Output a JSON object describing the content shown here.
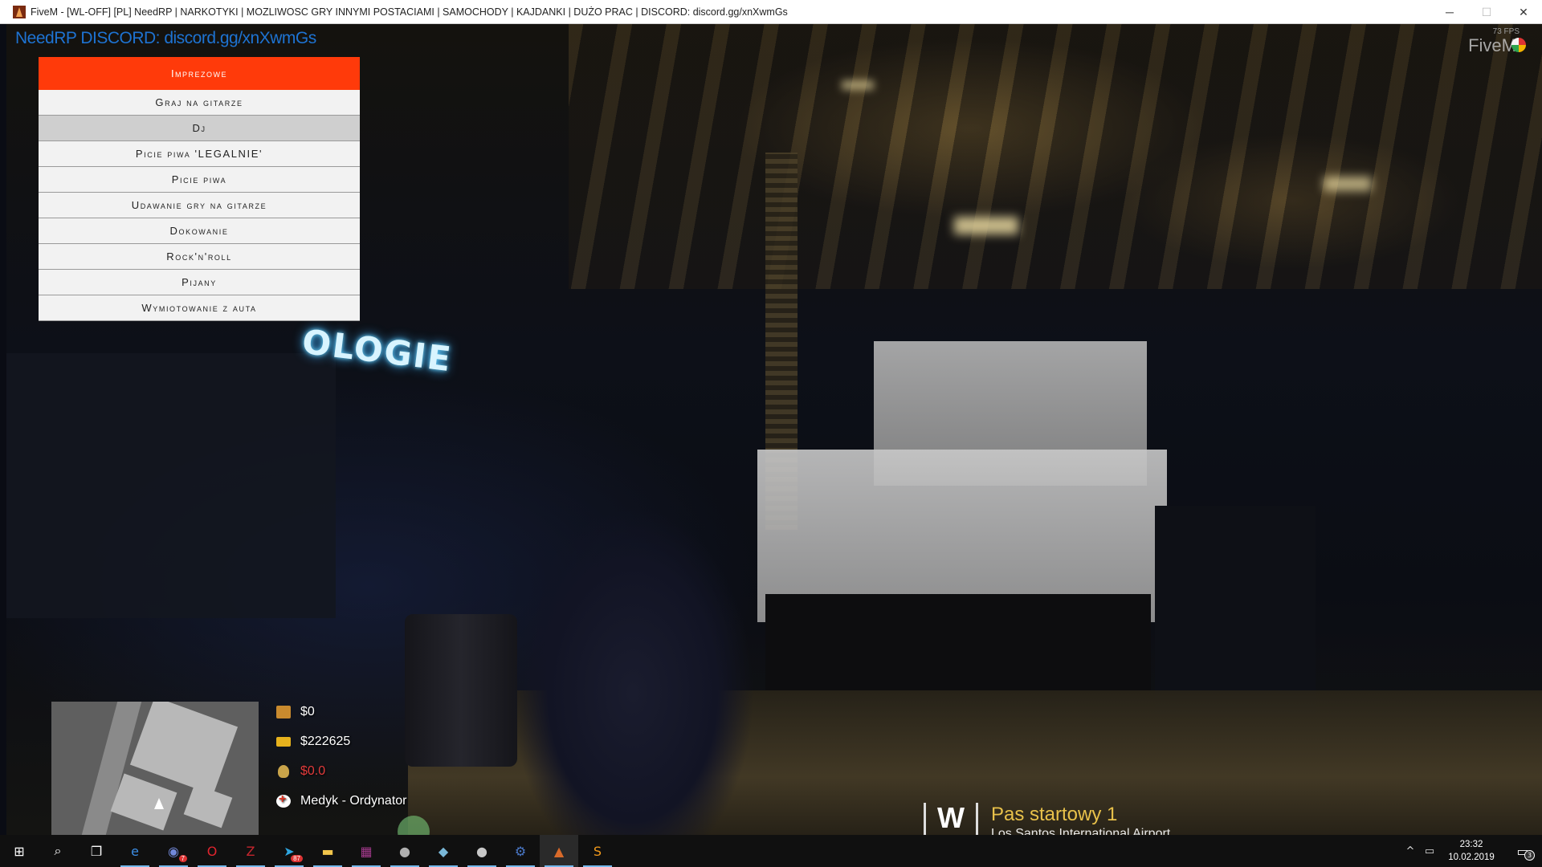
{
  "window": {
    "title": "FiveM - [WL-OFF] [PL] NeedRP | NARKOTYKI | MOZLIWOSC GRY INNYMI POSTACIAMI | SAMOCHODY | KAJDANKI | DUŻO PRAC | DISCORD: discord.gg/xnXwmGs",
    "minimize": "─",
    "maximize": "☐",
    "close": "✕"
  },
  "overlay": {
    "server_banner": "NeedRP DISCORD: discord.gg/xnXwmGs",
    "fps": "73 FPS",
    "brand": "FiveM",
    "neon_sign": "OLOGIE"
  },
  "menu": {
    "header": "Imprezowe",
    "selected_index": 1,
    "items": [
      {
        "label": "Graj na gitarze"
      },
      {
        "label": "Dj"
      },
      {
        "label": "Picie piwa 'LEGALNIE'"
      },
      {
        "label": "Picie piwa"
      },
      {
        "label": "Udawanie gry na gitarze"
      },
      {
        "label": "Dokowanie"
      },
      {
        "label": "Rock'n'roll"
      },
      {
        "label": "Pijany"
      },
      {
        "label": "Wymiotowanie z auta"
      }
    ]
  },
  "hud": {
    "cash": "$0",
    "bank": "$222625",
    "black_money": "$0.0",
    "job": "Medyk - Ordynator"
  },
  "location": {
    "direction": "W",
    "street": "Pas startowy 1",
    "area": "Los Santos International Airport"
  },
  "taskbar": {
    "apps": [
      {
        "name": "start-button",
        "glyph": "⊞",
        "color": "#ffffff"
      },
      {
        "name": "search-icon",
        "glyph": "⌕",
        "color": "#ffffff"
      },
      {
        "name": "task-view-icon",
        "glyph": "❐",
        "color": "#ffffff"
      },
      {
        "name": "edge-icon",
        "glyph": "e",
        "color": "#3c8ee6"
      },
      {
        "name": "discord-icon",
        "glyph": "◉",
        "color": "#7289da",
        "badge": "7"
      },
      {
        "name": "opera-icon",
        "glyph": "O",
        "color": "#e0242e"
      },
      {
        "name": "filezilla-icon",
        "glyph": "Z",
        "color": "#c6262e"
      },
      {
        "name": "telegram-icon",
        "glyph": "➤",
        "color": "#2ea6e0",
        "badge": "87"
      },
      {
        "name": "file-explorer-icon",
        "glyph": "▬",
        "color": "#f2c54b"
      },
      {
        "name": "winrar-icon",
        "glyph": "▦",
        "color": "#a33a8c"
      },
      {
        "name": "app-icon-1",
        "glyph": "●",
        "color": "#b0b0b0"
      },
      {
        "name": "app-icon-2",
        "glyph": "◆",
        "color": "#7ab8d8"
      },
      {
        "name": "app-icon-3",
        "glyph": "●",
        "color": "#c8c8c8"
      },
      {
        "name": "network-app-icon",
        "glyph": "⚙",
        "color": "#4a78c8"
      },
      {
        "name": "fivem-taskbar-icon",
        "glyph": "▲",
        "color": "#d86a2a"
      },
      {
        "name": "sublime-text-icon",
        "glyph": "S",
        "color": "#f29a1b"
      }
    ],
    "tray": {
      "chevron": "^",
      "network": "▭",
      "time": "23:32",
      "date": "10.02.2019",
      "notifications": "3"
    }
  }
}
